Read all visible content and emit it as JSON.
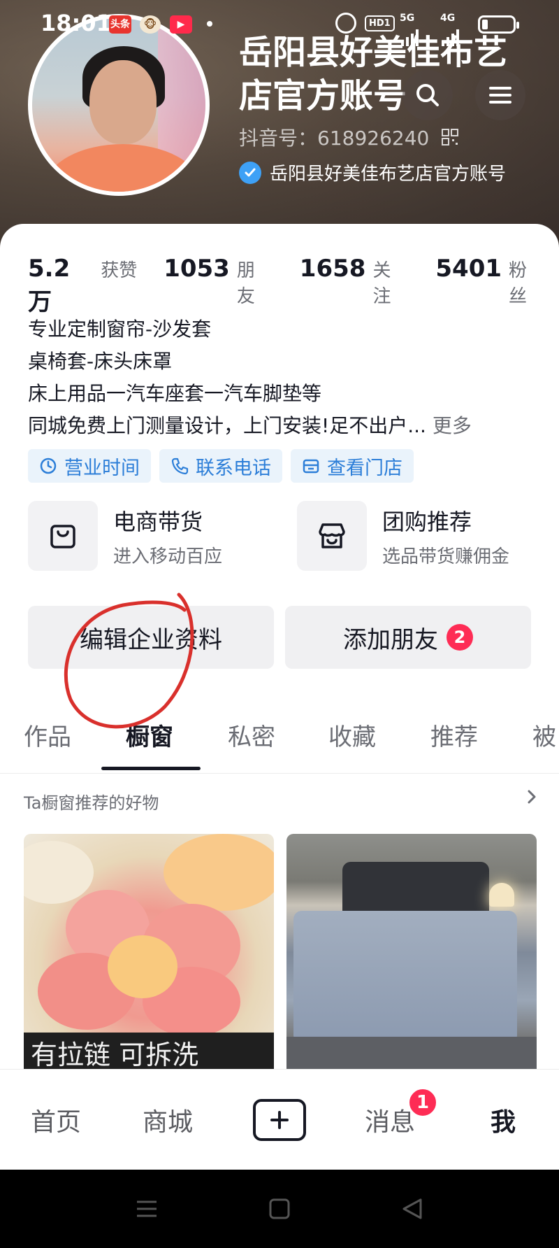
{
  "status_bar": {
    "time": "18:01",
    "toutiao_badge": "头条",
    "network_1": "5G",
    "network_2": "4G",
    "hd_label": "HD1"
  },
  "profile": {
    "name": "岳阳县好美佳布艺店官方账号",
    "douyin_id": "抖音号：618926240",
    "verified_label": "岳阳县好美佳布艺店官方账号"
  },
  "stats": [
    {
      "value": "5.2万",
      "label": "获赞"
    },
    {
      "value": "1053",
      "label": "朋友"
    },
    {
      "value": "1658",
      "label": "关注"
    },
    {
      "value": "5401",
      "label": "粉丝"
    }
  ],
  "bio": {
    "line1": "专业定制窗帘-沙发套",
    "line2": "桌椅套-床头床罩",
    "line3": "床上用品一汽车座套一汽车脚垫等",
    "line4": "同城免费上门测量设计，上门安装!足不出户...",
    "more": "更多"
  },
  "chips": [
    {
      "label": "营业时间",
      "icon": "clock-icon"
    },
    {
      "label": "联系电话",
      "icon": "phone-icon"
    },
    {
      "label": "查看门店",
      "icon": "store-icon"
    }
  ],
  "features": [
    {
      "title": "电商带货",
      "subtitle": "进入移动百应",
      "icon": "shopping-bag-icon"
    },
    {
      "title": "团购推荐",
      "subtitle": "选品带货赚佣金",
      "icon": "group-buy-icon"
    }
  ],
  "actions": {
    "edit_label": "编辑企业资料",
    "add_friend_label": "添加朋友",
    "add_friend_badge": "2"
  },
  "tabs": [
    {
      "label": "作品"
    },
    {
      "label": "橱窗"
    },
    {
      "label": "私密"
    },
    {
      "label": "收藏"
    },
    {
      "label": "推荐"
    },
    {
      "label": "被"
    }
  ],
  "active_tab": "橱窗",
  "recommend": {
    "title": "Ta橱窗推荐的好物"
  },
  "products": [
    {
      "caption": "有拉链 可拆洗"
    },
    {
      "caption": ""
    }
  ],
  "bottom_nav": {
    "home": "首页",
    "mall": "商城",
    "messages": "消息",
    "messages_badge": "1",
    "me": "我"
  },
  "colors": {
    "accent_red": "#fe2c55",
    "verified_blue": "#3ea1f6",
    "chip_blue": "#2c7ed8",
    "annotation_red": "#d9302c"
  }
}
